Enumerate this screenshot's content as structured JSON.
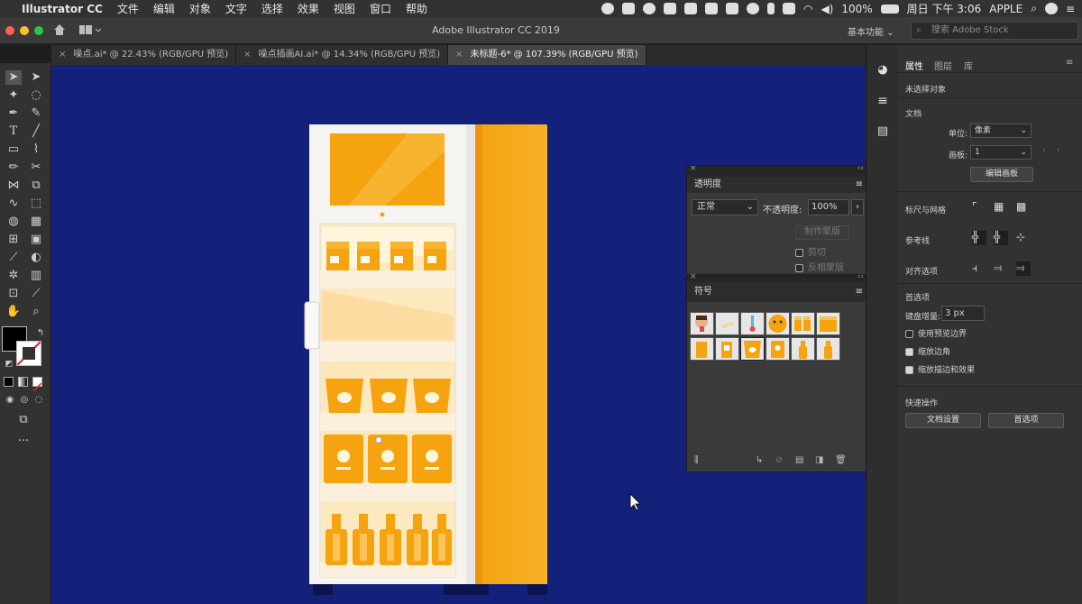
{
  "menubar": {
    "app": "Illustrator CC",
    "items": [
      "文件",
      "编辑",
      "对象",
      "文字",
      "选择",
      "效果",
      "视图",
      "窗口",
      "帮助"
    ],
    "battery": "100%",
    "datetime": "周日 下午 3:06",
    "user": "APPLE"
  },
  "appbar": {
    "title": "Adobe Illustrator CC 2019",
    "workspace": "基本功能",
    "search_placeholder": "搜索 Adobe Stock"
  },
  "tabs": [
    {
      "label": "噪点.ai* @ 22.43% (RGB/GPU 预览)"
    },
    {
      "label": "噪点插画AI.ai* @ 14.34% (RGB/GPU 预览)"
    },
    {
      "label": "未标题-6* @ 107.39% (RGB/GPU 预览)"
    }
  ],
  "colors": {
    "canvas": "#14217a",
    "accent": "#f5a623",
    "panel": "#323232"
  },
  "transparency": {
    "title": "透明度",
    "blend_mode": "正常",
    "opacity_label": "不透明度:",
    "opacity_value": "100%",
    "make_mask": "制作蒙版",
    "clip": "剪切",
    "invert": "反相蒙版"
  },
  "symbols": {
    "title": "符号"
  },
  "properties": {
    "tabs": [
      "属性",
      "图层",
      "库"
    ],
    "no_selection": "未选择对象",
    "doc_section": "文档",
    "unit_label": "单位:",
    "unit_value": "像素",
    "artboard_label": "画板:",
    "artboard_value": "1",
    "edit_artboard": "编辑画板",
    "rulers_grid": "标尺与网格",
    "guides": "参考线",
    "snap": "对齐选项",
    "prefs_section": "首选项",
    "keyboard_inc_label": "键盘增量:",
    "keyboard_inc_value": "3 px",
    "use_preview_bounds": "使用预览边界",
    "scale_corners": "缩放边角",
    "scale_strokes": "缩放描边和效果",
    "quick_actions": "快速操作",
    "doc_setup": "文档设置",
    "preferences": "首选项"
  }
}
